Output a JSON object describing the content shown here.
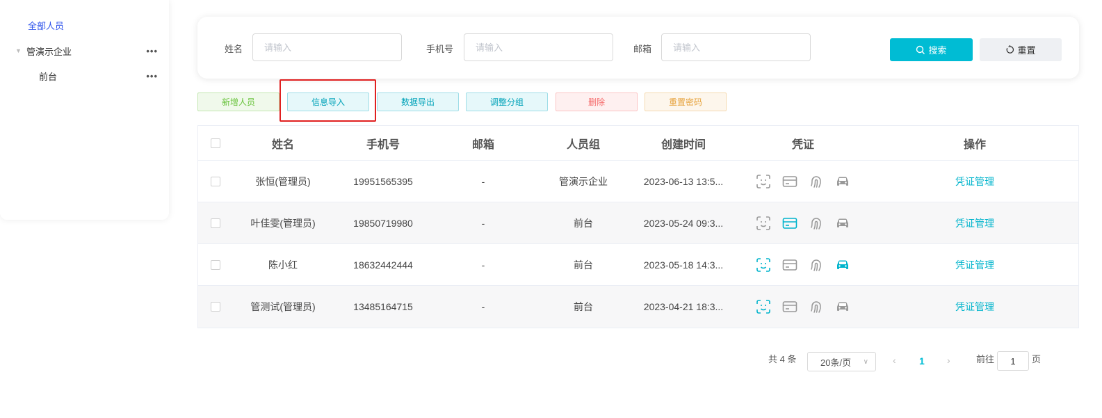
{
  "sidebar": {
    "all_label": "全部人员",
    "nodes": [
      {
        "label": "管演示企业",
        "more": "•••"
      },
      {
        "label": "前台",
        "more": "•••"
      }
    ]
  },
  "search": {
    "name_label": "姓名",
    "name_placeholder": "请输入",
    "phone_label": "手机号",
    "phone_placeholder": "请输入",
    "email_label": "邮箱",
    "email_placeholder": "请输入",
    "search_button": "搜索",
    "reset_button": "重置"
  },
  "toolbar": {
    "add": "新增人员",
    "import": "信息导入",
    "export": "数据导出",
    "regroup": "调整分组",
    "delete": "删除",
    "reset_password": "重置密码"
  },
  "table": {
    "headers": {
      "name": "姓名",
      "phone": "手机号",
      "email": "邮箱",
      "group": "人员组",
      "created": "创建时间",
      "credential": "凭证",
      "action": "操作"
    },
    "rows": [
      {
        "name": "张恒(管理员)",
        "phone": "19951565395",
        "email": "-",
        "group": "管演示企业",
        "created": "2023-06-13 13:5...",
        "action": "凭证管理",
        "creds": {
          "face": false,
          "card": false,
          "finger": false,
          "car": false
        }
      },
      {
        "name": "叶佳雯(管理员)",
        "phone": "19850719980",
        "email": "-",
        "group": "前台",
        "created": "2023-05-24 09:3...",
        "action": "凭证管理",
        "creds": {
          "face": false,
          "card": true,
          "finger": false,
          "car": false
        }
      },
      {
        "name": "陈小红",
        "phone": "18632442444",
        "email": "-",
        "group": "前台",
        "created": "2023-05-18 14:3...",
        "action": "凭证管理",
        "creds": {
          "face": true,
          "card": false,
          "finger": false,
          "car": true
        }
      },
      {
        "name": "管测试(管理员)",
        "phone": "13485164715",
        "email": "-",
        "group": "前台",
        "created": "2023-04-21 18:3...",
        "action": "凭证管理",
        "creds": {
          "face": true,
          "card": false,
          "finger": false,
          "car": false
        }
      }
    ]
  },
  "pagination": {
    "total": "共 4 条",
    "page_size": "20条/页",
    "current_page": "1",
    "goto_label": "前往",
    "goto_value": "1",
    "page_suffix": "页"
  },
  "colors": {
    "accent": "#00bcd4",
    "credential_active": "#00b4cc",
    "credential_inactive": "#999999",
    "highlight_box": "#e02020"
  }
}
